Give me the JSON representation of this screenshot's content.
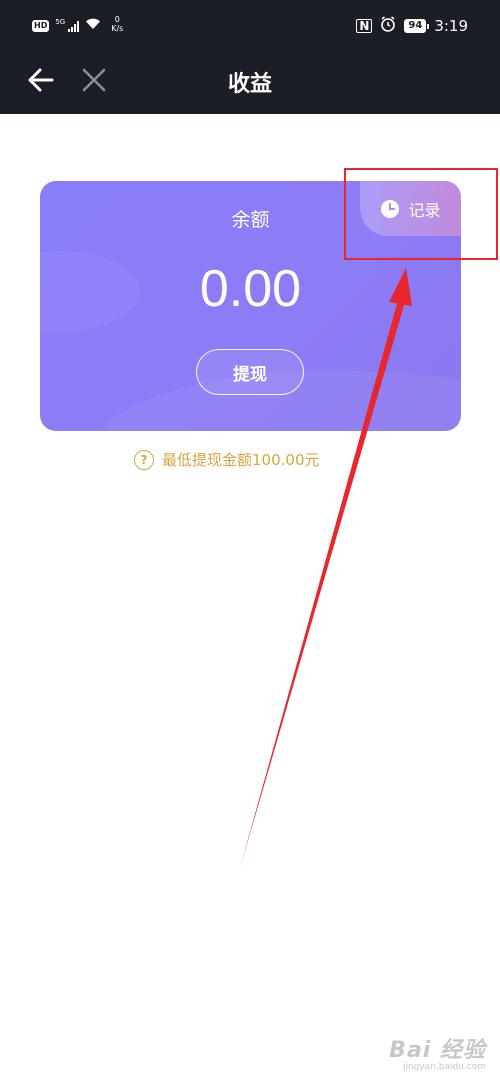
{
  "status_bar": {
    "hd": "HD",
    "network": "5G",
    "speed_value": "0",
    "speed_unit": "K/s",
    "nfc": "N",
    "battery": "94",
    "time": "3:19"
  },
  "nav": {
    "title": "收益",
    "back_icon": "arrow-left-icon",
    "close_icon": "close-icon"
  },
  "card": {
    "record_label": "记录",
    "record_icon": "clock-icon",
    "balance_label": "余额",
    "balance_amount": "0.00",
    "withdraw_label": "提现"
  },
  "hint": {
    "icon": "?",
    "text": "最低提现金额100.00元"
  },
  "watermark": {
    "main": "Bai 经验",
    "sub": "jingyan.baidu.com"
  },
  "colors": {
    "header_bg": "#1b1d27",
    "card_bg": "#8a7dfa",
    "hint_color": "#d9a441",
    "annotation": "#e8262b"
  }
}
